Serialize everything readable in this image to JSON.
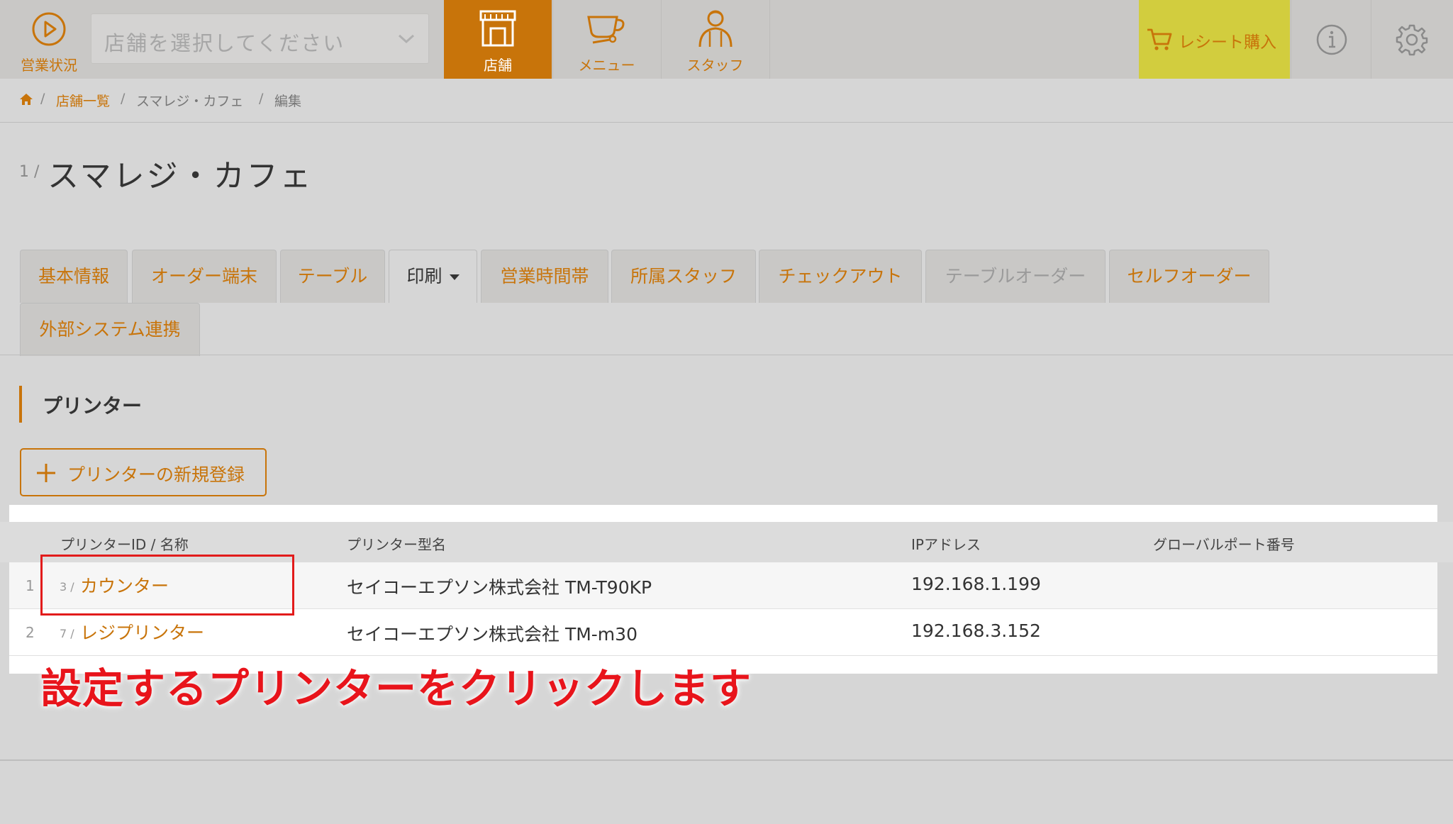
{
  "topbar": {
    "status_label": "営業状況",
    "store_select_placeholder": "店舗を選択してください",
    "nav": [
      {
        "label": "店舗",
        "icon": "store-icon",
        "active": true
      },
      {
        "label": "メニュー",
        "icon": "coffee-cup-icon",
        "active": false
      },
      {
        "label": "スタッフ",
        "icon": "staff-icon",
        "active": false
      }
    ],
    "receipt_label": "レシート購入",
    "info_icon": "info-icon",
    "settings_icon": "gear-icon"
  },
  "breadcrumb": {
    "home_icon": "home-icon",
    "store_list": "店舗一覧",
    "store_name": "スマレジ・カフェ",
    "current": "編集",
    "separator": "/"
  },
  "page": {
    "index": "1 /",
    "title": "スマレジ・カフェ"
  },
  "tabs": [
    {
      "label": "基本情報"
    },
    {
      "label": "オーダー端末"
    },
    {
      "label": "テーブル"
    },
    {
      "label": "印刷",
      "active": true
    },
    {
      "label": "営業時間帯"
    },
    {
      "label": "所属スタッフ"
    },
    {
      "label": "チェックアウト"
    },
    {
      "label": "テーブルオーダー",
      "disabled": true
    },
    {
      "label": "セルフオーダー"
    },
    {
      "label": "外部システム連携"
    }
  ],
  "section": {
    "title": "プリンター",
    "add_button": "プリンターの新規登録"
  },
  "table": {
    "headers": [
      "プリンターID / 名称",
      "プリンター型名",
      "IPアドレス",
      "グローバルポート番号"
    ],
    "rows": [
      {
        "num": "1",
        "id": "3 /",
        "name": "カウンター",
        "model": "セイコーエプソン株式会社 TM-T90KP",
        "ip": "192.168.1.199",
        "port": ""
      },
      {
        "num": "2",
        "id": "7 /",
        "name": "レジプリンター",
        "model": "セイコーエプソン株式会社 TM-m30",
        "ip": "192.168.3.152",
        "port": ""
      }
    ]
  },
  "annotation": "設定するプリンターをクリックします",
  "colors": {
    "accent": "#c8740a",
    "receipt_bg": "#d2cd3e",
    "annotation": "#e8141b"
  }
}
